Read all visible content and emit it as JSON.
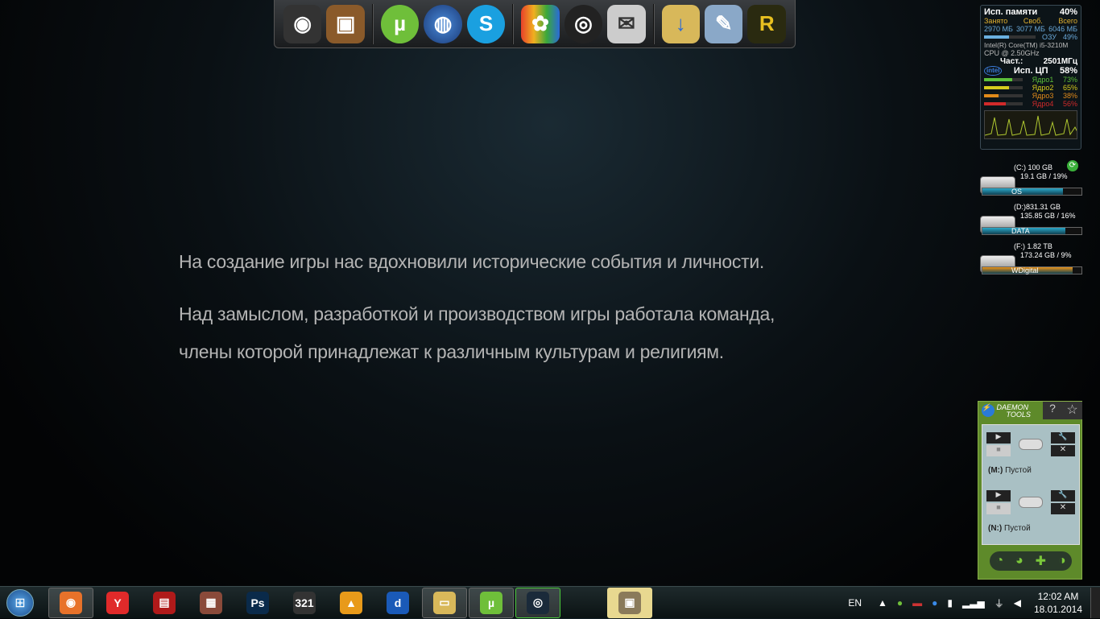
{
  "dock": {
    "icons": [
      "webcam-icon",
      "photos-icon",
      "utorrent-icon",
      "google-earth-icon",
      "skype-icon",
      "msn-icon",
      "disc-tool-icon",
      "mail-icon",
      "downloads-folder-icon",
      "notepad-icon",
      "rocketdock-icon"
    ]
  },
  "message": {
    "line1": "На создание игры нас вдохновили исторические события и личности.",
    "line2": "Над замыслом, разработкой и производством игры работала команда,",
    "line3": "члены которой принадлежат к различным культурам и религиям."
  },
  "sysmon": {
    "mem_title": "Исп. памяти",
    "mem_pct": "40%",
    "h_used": "Занято",
    "h_free": "Своб.",
    "h_total": "Всего",
    "used": "2970 МБ",
    "free": "3077 МБ",
    "total": "6046 МБ",
    "ram_label": "ОЗУ",
    "ram_pct": "49%",
    "cpu_name": "Intel(R) Core(TM) i5-3210M",
    "cpu_speed": "CPU @ 2.50GHz",
    "freq_label": "Част.:",
    "freq": "2501МГц",
    "cpu_title": "Исп. ЦП",
    "cpu_pct": "58%",
    "cores": [
      {
        "label": "Ядро1",
        "pct": "73%",
        "value": 73,
        "color": "#5cbf3a"
      },
      {
        "label": "Ядро2",
        "pct": "65%",
        "value": 65,
        "color": "#d6cc1e"
      },
      {
        "label": "Ядро3",
        "pct": "38%",
        "value": 38,
        "color": "#e08a1a"
      },
      {
        "label": "Ядро4",
        "pct": "56%",
        "value": 56,
        "color": "#d02a2a"
      }
    ]
  },
  "drives": [
    {
      "name": "(C:) 100 GB",
      "usage": "19.1 GB / 19%",
      "label": "OS",
      "fill": 81,
      "color": "#2aa8c8"
    },
    {
      "name": "(D:)831.31 GB",
      "usage": "135.85 GB / 16%",
      "label": "DATA",
      "fill": 84,
      "color": "#2aa8c8"
    },
    {
      "name": "(F:) 1.82 TB",
      "usage": "173.24 GB / 9%",
      "label": "WDigital",
      "fill": 91,
      "color": "#e8921a"
    }
  ],
  "daemon": {
    "title": "DAEMON",
    "subtitle": "TOOLS",
    "help": "?",
    "drives": [
      {
        "letter": "(M:)",
        "status": "Пустой"
      },
      {
        "letter": "(N:)",
        "status": "Пустой"
      }
    ]
  },
  "taskbar": {
    "apps": [
      "firefox",
      "yandex-browser",
      "reader",
      "winrar",
      "photoshop",
      "media-player-classic",
      "aimp",
      "deezer",
      "explorer",
      "utorrent",
      "steam",
      "game"
    ],
    "lang": "EN",
    "time": "12:02 AM",
    "date": "18.01.2014"
  }
}
